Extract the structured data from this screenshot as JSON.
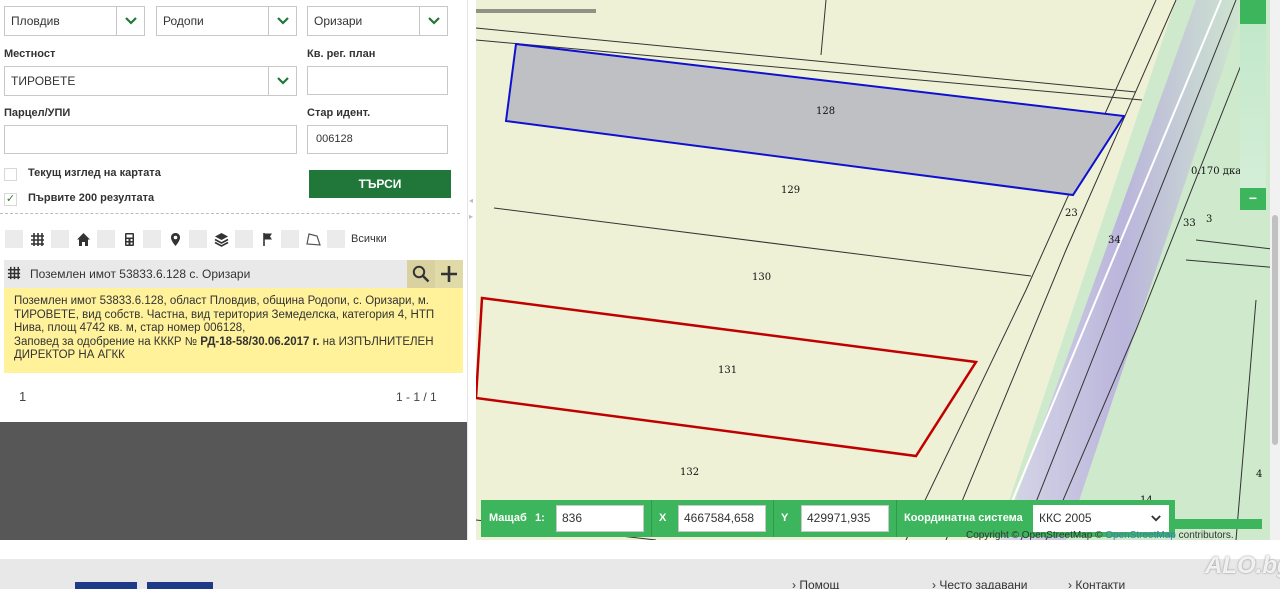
{
  "filters": {
    "oblast": "Пловдив",
    "obshtina": "Родопи",
    "zemlishte": "Оризари",
    "mestnost_label": "Местност",
    "mestnost": "ТИРОВЕТЕ",
    "kv_label": "Кв. рег. план",
    "kv_value": "",
    "parcel_label": "Парцел/УПИ",
    "parcel_value": "",
    "old_id_label": "Стар идент.",
    "old_id_value": "006128",
    "current_view_label": "Текущ изглед на картата",
    "current_view_checked": false,
    "first200_label": "Първите 200 резултата",
    "first200_checked": true,
    "check_mark": "✓",
    "search_button": "ТЪРСИ"
  },
  "type_filters": {
    "all_label": "Всички",
    "icons": [
      "grid-icon",
      "home-icon",
      "calculator-icon",
      "location-pin-icon",
      "layers-icon",
      "flag-icon",
      "polygon-icon"
    ]
  },
  "result": {
    "title": "Поземлен имот 53833.6.128 с. Оризари",
    "description": "Поземлен имот 53833.6.128, област Пловдив, община Родопи, с. Оризари, м. ТИРОВЕТЕ, вид собств. Частна, вид територия Земеделска, категория 4, НТП Нива, площ 4742 кв. м, стар номер 006128,",
    "order_prefix": "Заповед за одобрение на КККР №",
    "order_number": "РД-18-58/30.06.2017 г.",
    "order_suffix": "на ИЗПЪЛНИТЕЛЕН ДИРЕКТОР НА АГКК"
  },
  "pagination": {
    "page": "1",
    "range": "1 - 1 / 1"
  },
  "map": {
    "plots": [
      "128",
      "129",
      "130",
      "131",
      "132"
    ],
    "other_labels": [
      "23",
      "34",
      "33",
      "3",
      "14",
      "4"
    ],
    "area_label": "0.170 дка",
    "zoom_out": "−",
    "highlight_blue": "#1010d0",
    "highlight_red": "#c00000"
  },
  "map_bar": {
    "scale_label": "Мащаб",
    "scale_prefix": "1:",
    "scale_value": "836",
    "x_label": "X",
    "x_value": "4667584,658",
    "y_label": "Y",
    "y_value": "429971,935",
    "crs_label": "Координатна система",
    "crs_value": "ККС 2005"
  },
  "attribution": {
    "prefix": "Copyright © OpenStreetMap ©",
    "link": "OpenStreetMap",
    "suffix": "contributors."
  },
  "footer": {
    "links": [
      "› Помощ",
      "› Често задавани",
      "› Контакти"
    ],
    "watermark": "ALO.bg"
  },
  "colors": {
    "primary_green": "#21773a",
    "bar_green": "#3cb55c",
    "result_yellow": "#fff29a"
  }
}
